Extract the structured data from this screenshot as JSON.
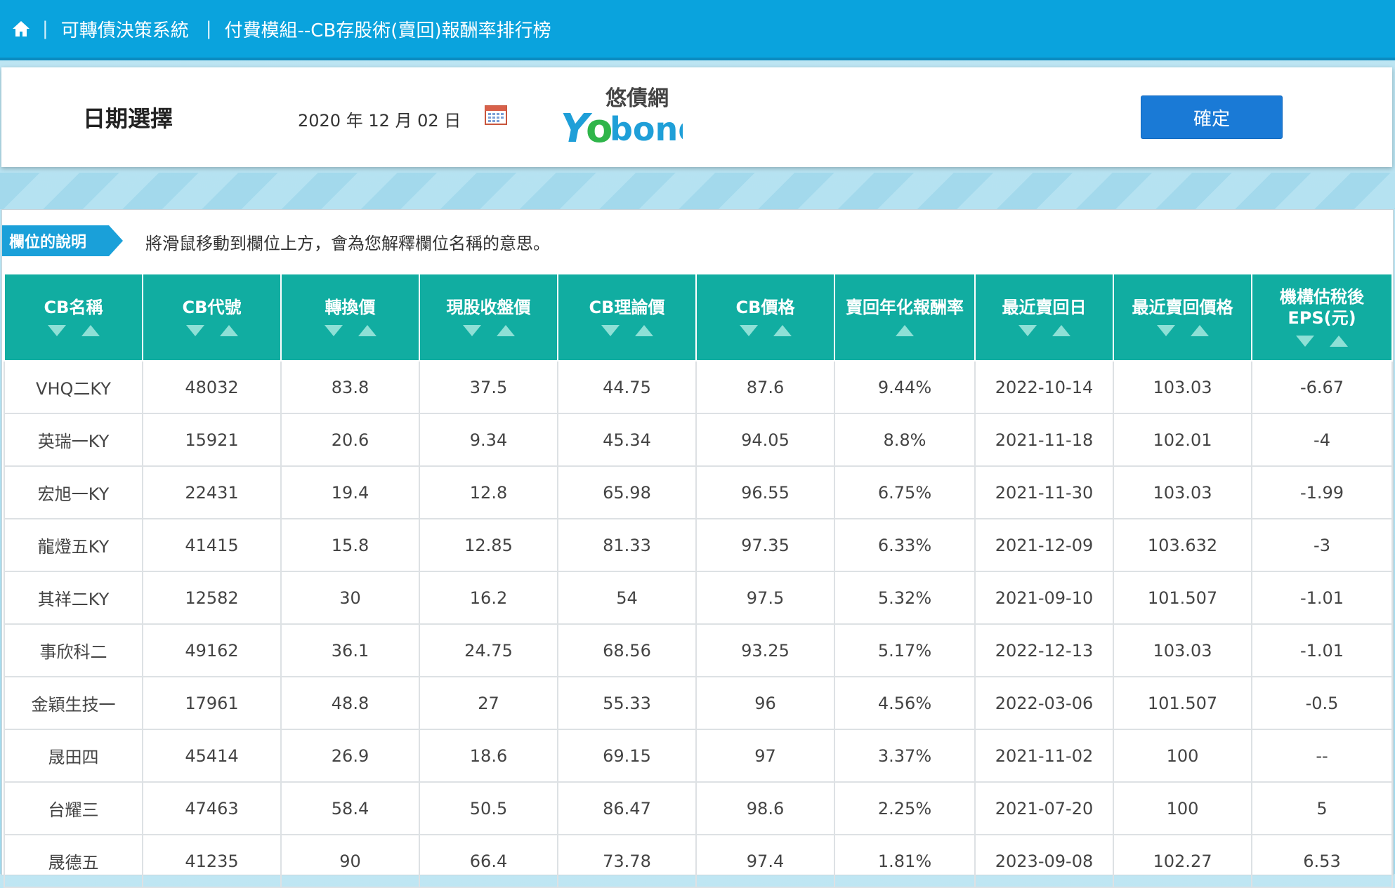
{
  "nav": {
    "home_icon": "home-icon",
    "crumb1": "可轉債決策系統",
    "crumb2": "付費模組--CB存股術(賣回)報酬率排行榜"
  },
  "date_panel": {
    "label": "日期選擇",
    "value": "2020 年 12 月 02 日",
    "calendar_icon": "calendar-icon",
    "logo_text_cn": "悠債網",
    "logo_text_en": "bond",
    "confirm_label": "確定"
  },
  "description": {
    "tag": "欄位的說明",
    "text": "將滑鼠移動到欄位上方，會為您解釋欄位名稱的意思。"
  },
  "colors": {
    "nav_bg": "#0aa3dd",
    "header_bg": "#11ada1",
    "button_bg": "#1a7ad6",
    "tag_bg": "#1aa0d9"
  },
  "table": {
    "columns": [
      {
        "label": "CB名稱",
        "sort": "both"
      },
      {
        "label": "CB代號",
        "sort": "both"
      },
      {
        "label": "轉換價",
        "sort": "both"
      },
      {
        "label": "現股收盤價",
        "sort": "both"
      },
      {
        "label": "CB理論價",
        "sort": "both"
      },
      {
        "label": "CB價格",
        "sort": "both"
      },
      {
        "label": "賣回年化報酬率",
        "sort": "up"
      },
      {
        "label": "最近賣回日",
        "sort": "both"
      },
      {
        "label": "最近賣回價格",
        "sort": "both"
      },
      {
        "label": "機構估稅後EPS(元)",
        "sort": "both"
      }
    ],
    "rows": [
      [
        "VHQ二KY",
        "48032",
        "83.8",
        "37.5",
        "44.75",
        "87.6",
        "9.44%",
        "2022-10-14",
        "103.03",
        "-6.67"
      ],
      [
        "英瑞一KY",
        "15921",
        "20.6",
        "9.34",
        "45.34",
        "94.05",
        "8.8%",
        "2021-11-18",
        "102.01",
        "-4"
      ],
      [
        "宏旭一KY",
        "22431",
        "19.4",
        "12.8",
        "65.98",
        "96.55",
        "6.75%",
        "2021-11-30",
        "103.03",
        "-1.99"
      ],
      [
        "龍燈五KY",
        "41415",
        "15.8",
        "12.85",
        "81.33",
        "97.35",
        "6.33%",
        "2021-12-09",
        "103.632",
        "-3"
      ],
      [
        "其祥二KY",
        "12582",
        "30",
        "16.2",
        "54",
        "97.5",
        "5.32%",
        "2021-09-10",
        "101.507",
        "-1.01"
      ],
      [
        "事欣科二",
        "49162",
        "36.1",
        "24.75",
        "68.56",
        "93.25",
        "5.17%",
        "2022-12-13",
        "103.03",
        "-1.01"
      ],
      [
        "金穎生技一",
        "17961",
        "48.8",
        "27",
        "55.33",
        "96",
        "4.56%",
        "2022-03-06",
        "101.507",
        "-0.5"
      ],
      [
        "晟田四",
        "45414",
        "26.9",
        "18.6",
        "69.15",
        "97",
        "3.37%",
        "2021-11-02",
        "100",
        "--"
      ],
      [
        "台耀三",
        "47463",
        "58.4",
        "50.5",
        "86.47",
        "98.6",
        "2.25%",
        "2021-07-20",
        "100",
        "5"
      ],
      [
        "晟德五",
        "41235",
        "90",
        "66.4",
        "73.78",
        "97.4",
        "1.81%",
        "2023-09-08",
        "102.27",
        "6.53"
      ]
    ]
  }
}
